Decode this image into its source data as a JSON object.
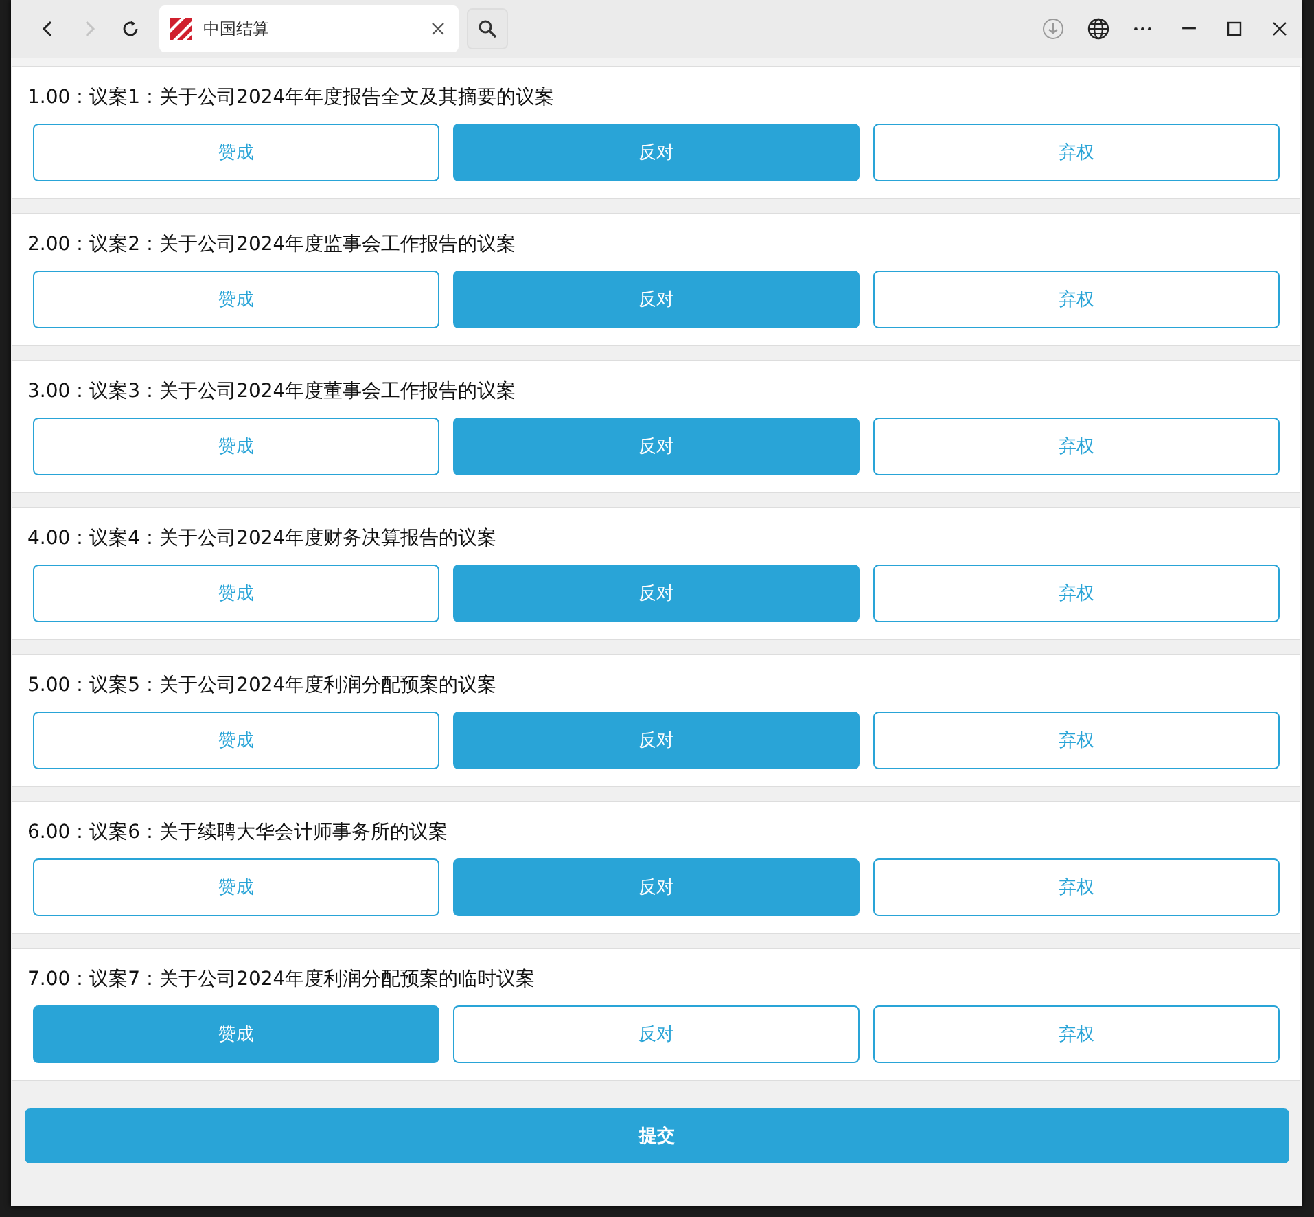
{
  "browser": {
    "nav_buttons": [
      {
        "kind": "back",
        "disabled": false
      },
      {
        "kind": "forward",
        "disabled": true
      },
      {
        "kind": "reload",
        "disabled": false
      }
    ],
    "tab": {
      "title": "中国结算"
    }
  },
  "proposals": [
    {
      "title": "1.00：议案1：关于公司2024年年度报告全文及其摘要的议案",
      "options": [
        {
          "label": "赞成",
          "selected": false
        },
        {
          "label": "反对",
          "selected": true
        },
        {
          "label": "弃权",
          "selected": false
        }
      ]
    },
    {
      "title": "2.00：议案2：关于公司2024年度监事会工作报告的议案",
      "options": [
        {
          "label": "赞成",
          "selected": false
        },
        {
          "label": "反对",
          "selected": true
        },
        {
          "label": "弃权",
          "selected": false
        }
      ]
    },
    {
      "title": "3.00：议案3：关于公司2024年度董事会工作报告的议案",
      "options": [
        {
          "label": "赞成",
          "selected": false
        },
        {
          "label": "反对",
          "selected": true
        },
        {
          "label": "弃权",
          "selected": false
        }
      ]
    },
    {
      "title": "4.00：议案4：关于公司2024年度财务决算报告的议案",
      "options": [
        {
          "label": "赞成",
          "selected": false
        },
        {
          "label": "反对",
          "selected": true
        },
        {
          "label": "弃权",
          "selected": false
        }
      ]
    },
    {
      "title": "5.00：议案5：关于公司2024年度利润分配预案的议案",
      "options": [
        {
          "label": "赞成",
          "selected": false
        },
        {
          "label": "反对",
          "selected": true
        },
        {
          "label": "弃权",
          "selected": false
        }
      ]
    },
    {
      "title": "6.00：议案6：关于续聘大华会计师事务所的议案",
      "options": [
        {
          "label": "赞成",
          "selected": false
        },
        {
          "label": "反对",
          "selected": true
        },
        {
          "label": "弃权",
          "selected": false
        }
      ]
    },
    {
      "title": "7.00：议案7：关于公司2024年度利润分配预案的临时议案",
      "options": [
        {
          "label": "赞成",
          "selected": true
        },
        {
          "label": "反对",
          "selected": false
        },
        {
          "label": "弃权",
          "selected": false
        }
      ]
    }
  ],
  "submit_button": "提交"
}
